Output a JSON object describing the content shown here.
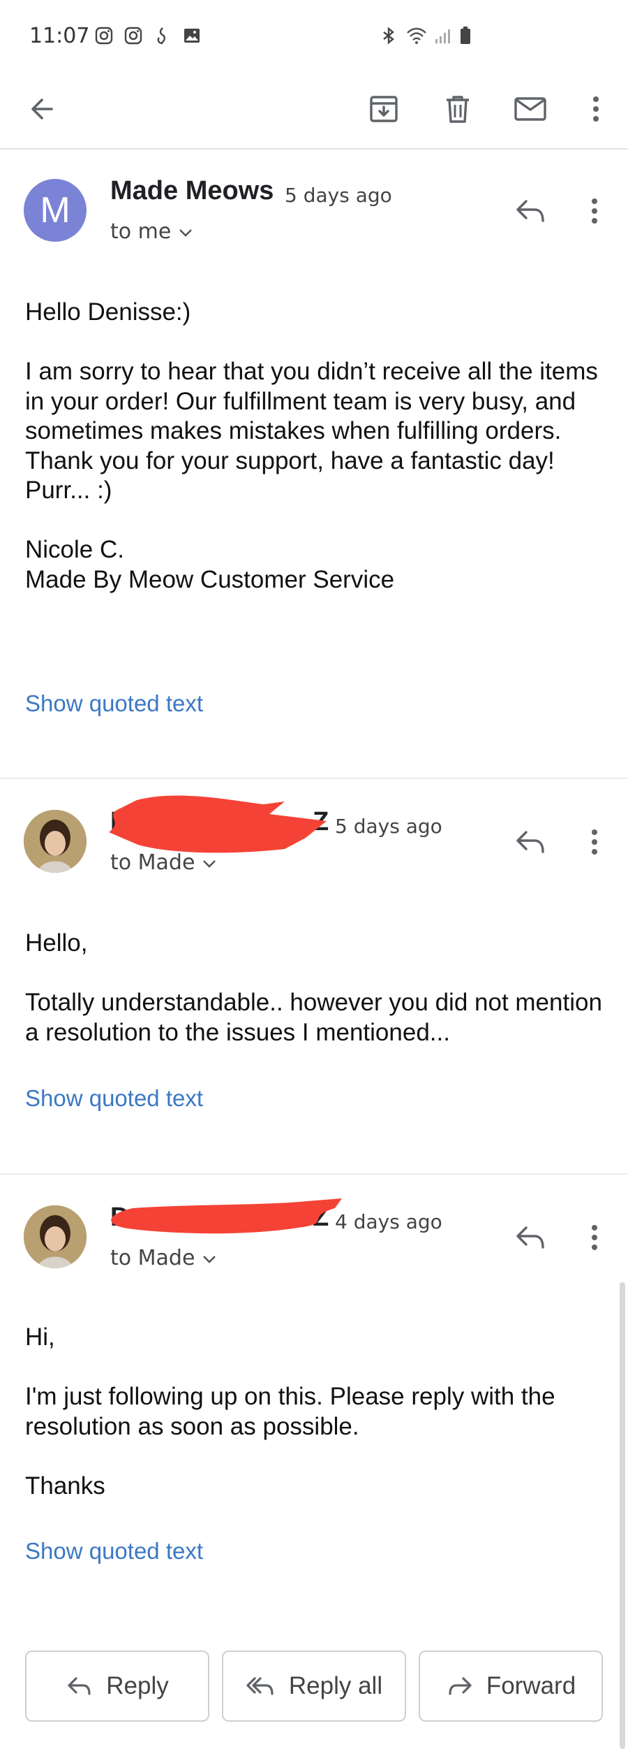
{
  "status_bar": {
    "time": "11:07",
    "left_icons": [
      "instagram-icon",
      "instagram-icon",
      "notification-icon",
      "image-icon"
    ],
    "right_icons": [
      "bluetooth-icon",
      "wifi-icon",
      "signal-icon",
      "battery-icon"
    ]
  },
  "toolbar": {
    "icons": [
      "back-arrow-icon",
      "archive-icon",
      "delete-icon",
      "mark-unread-icon",
      "more-vert-icon"
    ]
  },
  "messages": [
    {
      "avatar_letter": "M",
      "avatar_color": "#7b83d6",
      "sender": "Made Meows",
      "ago": "5 days ago",
      "recipient": "to me",
      "body": "Hello Denisse:)\n\nI am sorry to hear that you didn’t receive all the items in your order! Our fulfillment team is very busy, and sometimes makes mistakes when fulfilling orders.\nThank you for your support, have a fantastic day! Purr...  :)\n\nNicole C.\nMade By Meow Customer Service",
      "quoted_link": "Show quoted text"
    },
    {
      "sender": "D",
      "sender_end": "Z",
      "ago": "5 days ago",
      "recipient": "to Made",
      "body": "Hello,\n\nTotally understandable.. however you did not mention a resolution to the issues I mentioned...",
      "quoted_link": "Show quoted text"
    },
    {
      "sender": "D",
      "sender_end": "Z",
      "ago": "4 days ago",
      "recipient": "to Made",
      "body": "Hi,\n\nI'm just following up on this.  Please reply with the resolution as soon as possible.\n\nThanks",
      "quoted_link": "Show quoted text"
    }
  ],
  "actions": {
    "reply": "Reply",
    "reply_all": "Reply all",
    "forward": "Forward"
  },
  "colors": {
    "link": "#3b78c4",
    "redaction": "#f44336",
    "avatar_m": "#7b83d6"
  }
}
